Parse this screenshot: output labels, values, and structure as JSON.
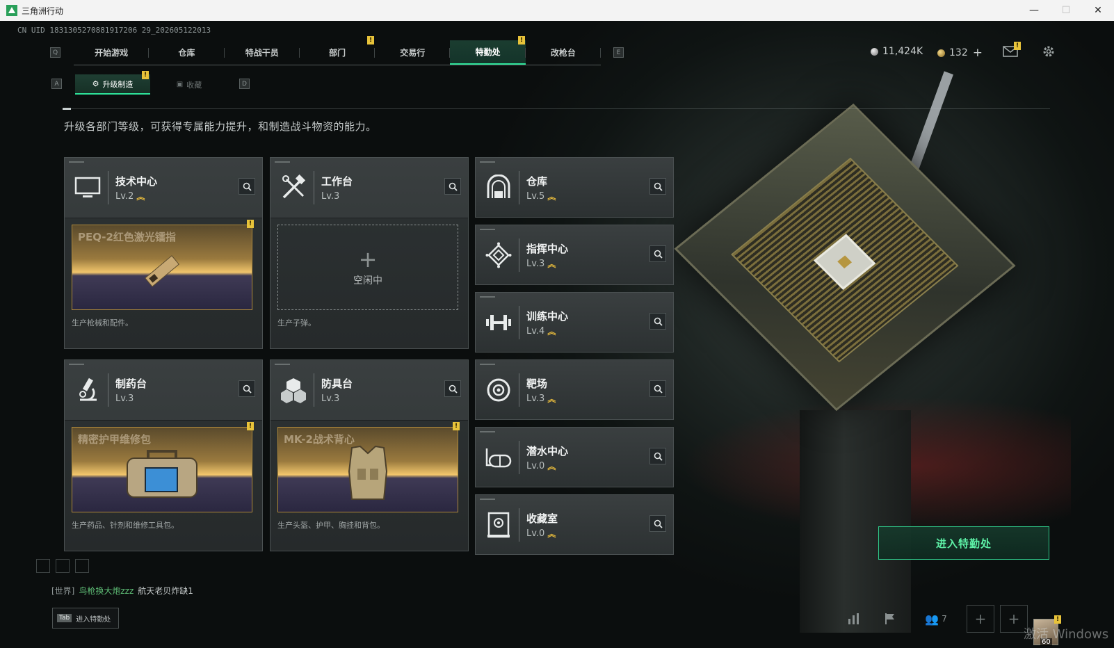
{
  "window": {
    "title": "三角洲行动",
    "minimize": "—",
    "maximize": "☐",
    "close": "✕"
  },
  "uid": "CN UID 1831305270881917206 29_202605122013",
  "nav": {
    "key_left": "Q",
    "key_right": "E",
    "tabs": [
      "开始游戏",
      "仓库",
      "特战干员",
      "部门",
      "交易行",
      "特勤处",
      "改枪台"
    ],
    "active_tab": "特勤处"
  },
  "currency": {
    "silver": "11,424K",
    "gold": "132",
    "plus": "+"
  },
  "subtabs": {
    "key_left": "A",
    "key_right": "D",
    "upgrade": "升级制造",
    "collect": "收藏"
  },
  "description": "升级各部门等级，可获得专属能力提升，和制造战斗物资的能力。",
  "alert_mark": "!",
  "departments": {
    "tech": {
      "name": "技术中心",
      "level": "Lv.2",
      "product": "PEQ-2红色激光镭指",
      "desc": "生产枪械和配件。"
    },
    "workbench": {
      "name": "工作台",
      "level": "Lv.3",
      "idle": "空闲中",
      "desc": "生产子弹。"
    },
    "warehouse": {
      "name": "仓库",
      "level": "Lv.5"
    },
    "command": {
      "name": "指挥中心",
      "level": "Lv.3"
    },
    "training": {
      "name": "训练中心",
      "level": "Lv.4"
    },
    "pharmacy": {
      "name": "制药台",
      "level": "Lv.3",
      "product": "精密护甲维修包",
      "desc": "生产药品、针剂和维修工具包。"
    },
    "armor": {
      "name": "防具台",
      "level": "Lv.3",
      "product": "MK-2战术背心",
      "desc": "生产头盔、护甲、胸挂和背包。"
    },
    "range": {
      "name": "靶场",
      "level": "Lv.3"
    },
    "diving": {
      "name": "潜水中心",
      "level": "Lv.0"
    },
    "collection": {
      "name": "收藏室",
      "level": "Lv.0"
    }
  },
  "enter_button": "进入特勤处",
  "chat": {
    "channel": "[世界]",
    "user": "鸟枪换大炮zzz",
    "message": "航天老贝炸缺1"
  },
  "tab_hint": {
    "key": "Tab",
    "label": "进入特勤处"
  },
  "hud": {
    "friends_count": "7",
    "avatar_level": "60",
    "watermark": "激活 Windows"
  },
  "colors": {
    "accent": "#2ee39a",
    "alert": "#e8c33a",
    "upgrade": "#e2b73c"
  }
}
